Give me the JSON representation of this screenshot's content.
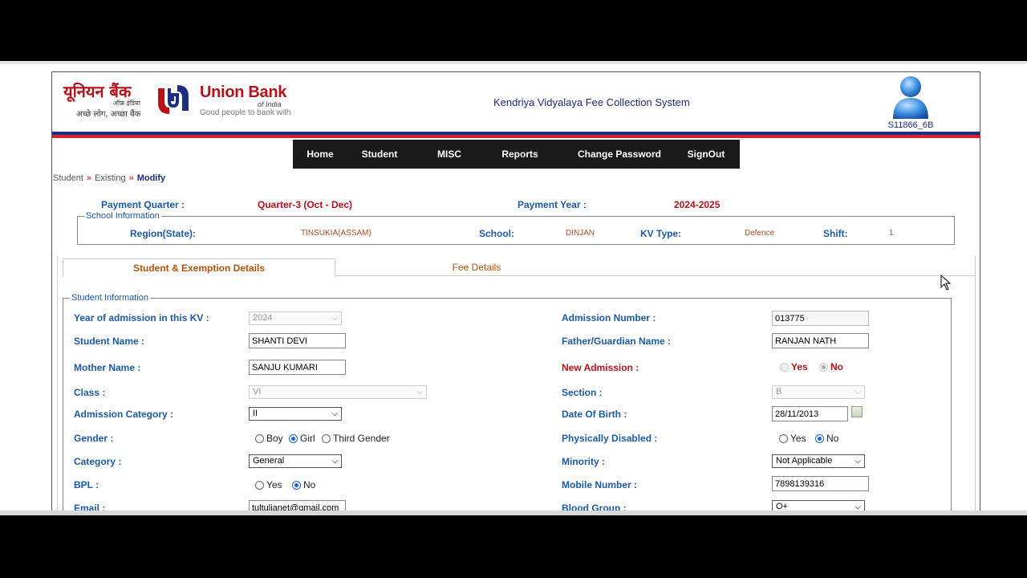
{
  "header": {
    "logo_hindi": "यूनियन बैंक",
    "logo_hindi_sub": "ऑफ़ इंडिया",
    "logo_hindi_tag": "अच्छे लोग, अच्छा बैंक",
    "logo_en": "Union Bank",
    "logo_en_sub": "of India",
    "logo_en_tag": "Good people to bank with",
    "app_title": "Kendriya Vidyalaya Fee Collection System",
    "user_id": "S11866_6B"
  },
  "colors": {
    "brand_red": "#b5121b",
    "brand_blue": "#1d2e82",
    "label_blue": "#1d5aa8",
    "tab_orange": "#b8520a"
  },
  "nav": {
    "home": "Home",
    "student": "Student",
    "misc": "MISC",
    "reports": "Reports",
    "change_password": "Change Password",
    "signout": "SignOut"
  },
  "breadcrumb": {
    "b1": "Student",
    "sep": "»",
    "b2": "Existing",
    "b3": "Modify"
  },
  "payment": {
    "quarter_label": "Payment Quarter :",
    "quarter_value": "Quarter-3 (Oct - Dec)",
    "year_label": "Payment Year :",
    "year_value": "2024-2025"
  },
  "school_info": {
    "legend": "School Information",
    "region_label": "Region(State):",
    "region_value": "TINSUKIA(ASSAM)",
    "school_label": "School:",
    "school_value": "DINJAN",
    "kvtype_label": "KV Type:",
    "kvtype_value": "Defence",
    "shift_label": "Shift:",
    "shift_value": "1"
  },
  "tabs": {
    "tab1": "Student & Exemption Details",
    "tab2": "Fee Details"
  },
  "student": {
    "legend": "Student Information",
    "year_label": "Year of admission in this KV :",
    "year_value": "2024",
    "admno_label": "Admission Number :",
    "admno_value": "013775",
    "name_label": "Student Name :",
    "name_value": "SHANTI DEVI",
    "father_label": "Father/Guardian Name :",
    "father_value": "RANJAN NATH",
    "mother_label": "Mother Name :",
    "mother_value": "SANJU KUMARI",
    "newadm_label": "New Admission :",
    "yes": "Yes",
    "no": "No",
    "class_label": "Class :",
    "class_value": "VI",
    "section_label": "Section :",
    "section_value": "B",
    "admcat_label": "Admission Category :",
    "admcat_value": "II",
    "dob_label": "Date Of Birth :",
    "dob_value": "28/11/2013",
    "gender_label": "Gender :",
    "boy": "Boy",
    "girl": "Girl",
    "third": "Third Gender",
    "ph_label": "Physically Disabled :",
    "category_label": "Category :",
    "category_value": "General",
    "minority_label": "Minority :",
    "minority_value": "Not Applicable",
    "bpl_label": "BPL :",
    "mobile_label": "Mobile Number :",
    "mobile_value": "7898139316",
    "email_label": "Email :",
    "email_value": "tultulianet@gmail.com",
    "blood_label": "Blood Group :",
    "blood_value": "O+"
  }
}
